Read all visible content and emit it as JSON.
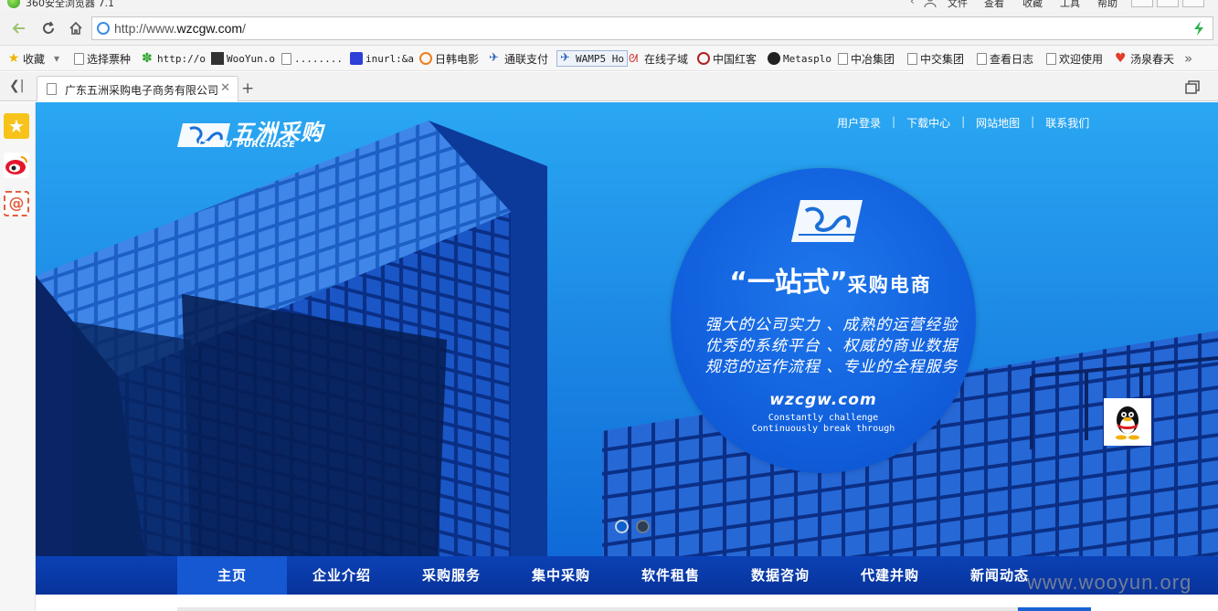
{
  "window": {
    "title": "360安全浏览器 7.1",
    "menu": [
      "文件",
      "查看",
      "收藏",
      "工具",
      "帮助"
    ]
  },
  "address_bar": {
    "url_prefix": "http://www.",
    "url_domain": "wzcgw.com",
    "url_suffix": "/"
  },
  "bookmarks": [
    {
      "label": "收藏",
      "icon": "star-icon"
    },
    {
      "label": "选择票种",
      "icon": "page-icon"
    },
    {
      "label": "http://o",
      "icon": "gear-green-icon"
    },
    {
      "label": "WooYun.o",
      "icon": "wooyun-icon"
    },
    {
      "label": "........",
      "icon": "page-icon"
    },
    {
      "label": "inurl:&a",
      "icon": "baidu-paw-icon"
    },
    {
      "label": "日韩电影",
      "icon": "play-icon"
    },
    {
      "label": "通联支付",
      "icon": "plane-icon"
    },
    {
      "label": "WAMP5 Ho",
      "icon": "plane-icon"
    },
    {
      "label": "在线子域",
      "icon": "cat-icon"
    },
    {
      "label": "中国红客",
      "icon": "hacker-icon"
    },
    {
      "label": "Metasplo",
      "icon": "metasploit-icon"
    },
    {
      "label": "中冶集团",
      "icon": "page-icon"
    },
    {
      "label": "中交集团",
      "icon": "page-icon"
    },
    {
      "label": "查看日志",
      "icon": "page-icon"
    },
    {
      "label": "欢迎使用",
      "icon": "page-icon"
    },
    {
      "label": "汤泉春天",
      "icon": "heart-icon"
    },
    {
      "label": "»",
      "icon": "more-icon"
    }
  ],
  "tab": {
    "title": "广东五洲采购电子商务有限公司"
  },
  "site": {
    "logo_cn": "五洲采购",
    "logo_en": "UZHOU PURCHASE",
    "top_links": [
      "用户登录",
      "下载中心",
      "网站地图",
      "联系我们"
    ],
    "hero": {
      "headline_quote": "“一站式”",
      "headline_rest": "采购电商",
      "lines": [
        "强大的公司实力 、成熟的运营经验",
        "优秀的系统平台 、权威的商业数据",
        "规范的运作流程 、专业的全程服务"
      ],
      "site": "wzcgw.com",
      "tagline_1": "Constantly challenge",
      "tagline_2": "Continuously break through"
    },
    "slides_total": 2,
    "slide_active": 1,
    "nav": [
      "主页",
      "企业介绍",
      "采购服务",
      "集中采购",
      "软件租售",
      "数据咨询",
      "代建并购",
      "新闻动态"
    ],
    "nav_active": "主页"
  },
  "watermark": "www.wooyun.org",
  "colors": {
    "hero_blue": "#0f6ad7",
    "nav_blue": "#0b41b6",
    "nav_active": "#1658d2"
  }
}
